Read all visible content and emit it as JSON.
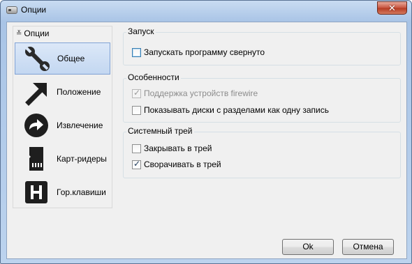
{
  "window": {
    "title": "Опции",
    "close_label": "✕"
  },
  "nav": {
    "header": "Опции",
    "items": [
      {
        "label": "Общее",
        "icon": "wrench-icon",
        "selected": true
      },
      {
        "label": "Положение",
        "icon": "arrow-icon",
        "selected": false
      },
      {
        "label": "Извлечение",
        "icon": "eject-arrow-icon",
        "selected": false
      },
      {
        "label": "Карт-ридеры",
        "icon": "sd-card-icon",
        "selected": false
      },
      {
        "label": "Гор.клавиши",
        "icon": "hotkey-h-icon",
        "selected": false
      }
    ]
  },
  "groups": {
    "startup": {
      "title": "Запуск",
      "options": [
        {
          "label": "Запускать программу свернуто",
          "checked": false,
          "disabled": false
        }
      ]
    },
    "features": {
      "title": "Особенности",
      "options": [
        {
          "label": "Поддержка устройств firewire",
          "checked": true,
          "disabled": true
        },
        {
          "label": "Показывать диски с разделами как одну запись",
          "checked": false,
          "disabled": false
        }
      ]
    },
    "tray": {
      "title": "Системный трей",
      "options": [
        {
          "label": "Закрывать в трей",
          "checked": false,
          "disabled": false
        },
        {
          "label": "Сворачивать в трей",
          "checked": true,
          "disabled": false
        }
      ]
    }
  },
  "buttons": {
    "ok": "Ok",
    "cancel": "Отмена"
  }
}
